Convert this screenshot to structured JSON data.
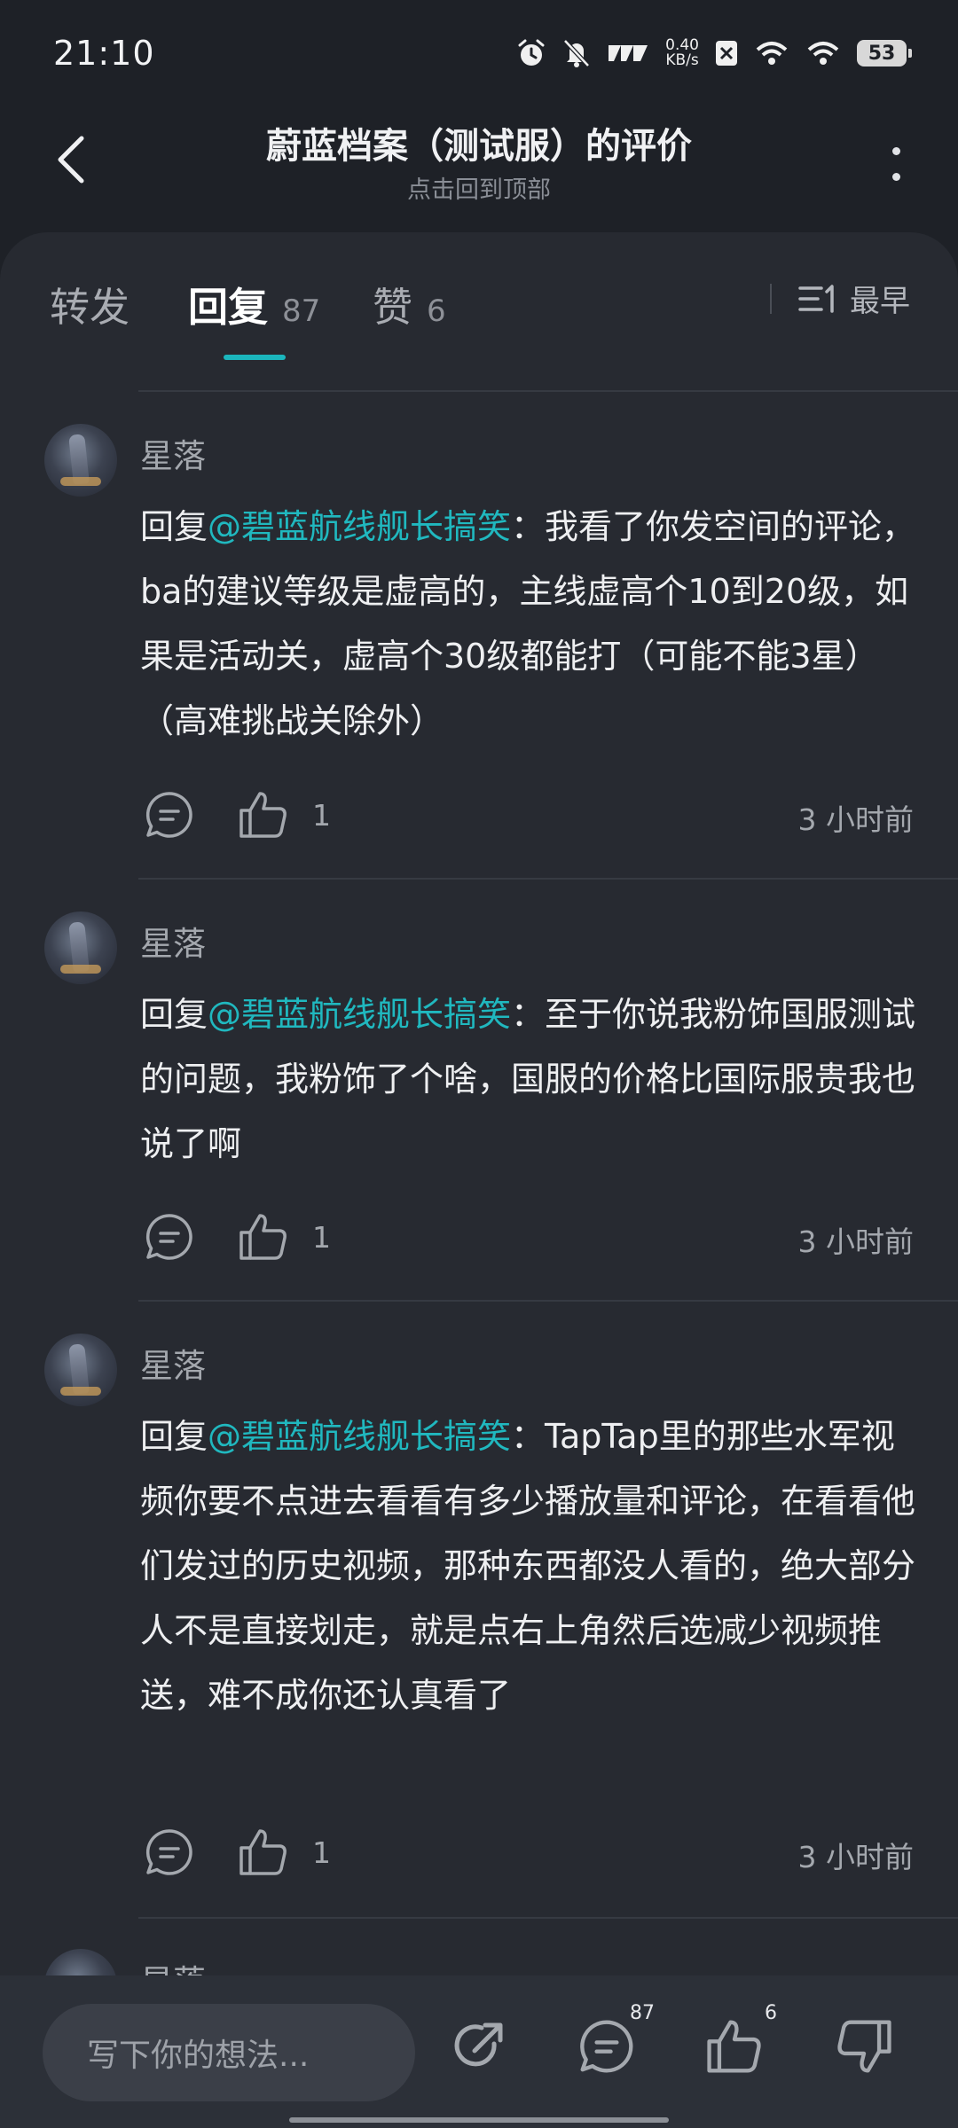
{
  "status_bar": {
    "time": "21:10",
    "net_speed_value": "0.40",
    "net_speed_unit": "KB/s",
    "battery": "53",
    "icons": [
      "alarm-icon",
      "mute-icon",
      "carrier-icon",
      "x-icon",
      "wifi-6-icon",
      "wifi-icon",
      "battery-icon"
    ]
  },
  "header": {
    "title": "蔚蓝档案（测试服）的评价",
    "subtitle": "点击回到顶部"
  },
  "tabs": [
    {
      "label": "转发",
      "count": ""
    },
    {
      "label": "回复",
      "count": "87"
    },
    {
      "label": "赞",
      "count": "6"
    }
  ],
  "sort": {
    "label": "最早"
  },
  "comments": [
    {
      "user": "星落",
      "prefix": "回复",
      "mention": "@碧蓝航线舰长搞笑",
      "text": "：我看了你发空间的评论，ba的建议等级是虚高的，主线虚高个10到20级，如果是活动关，虚高个30级都能打（可能不能3星）（高难挑战关除外）",
      "likes": "1",
      "time": "3 小时前"
    },
    {
      "user": "星落",
      "prefix": "回复",
      "mention": "@碧蓝航线舰长搞笑",
      "text": "：至于你说我粉饰国服测试的问题，我粉饰了个啥，国服的价格比国际服贵我也说了啊",
      "likes": "1",
      "time": "3 小时前"
    },
    {
      "user": "星落",
      "prefix": "回复",
      "mention": "@碧蓝航线舰长搞笑",
      "text": "：TapTap里的那些水军视频你要不点进去看看有多少播放量和评论，在看看他们发过的历史视频，那种东西都没人看的，绝大部分人不是直接划走，就是点右上角然后选减少视频推送，难不成你还认真看了",
      "likes": "1",
      "time": "3 小时前"
    }
  ],
  "peek_user": "星落",
  "bottom_bar": {
    "input_placeholder": "写下你的想法...",
    "reply_count": "87",
    "like_count": "6"
  },
  "colors": {
    "accent": "#1bb6bd",
    "background": "#1e2127",
    "panel": "#272a31"
  }
}
